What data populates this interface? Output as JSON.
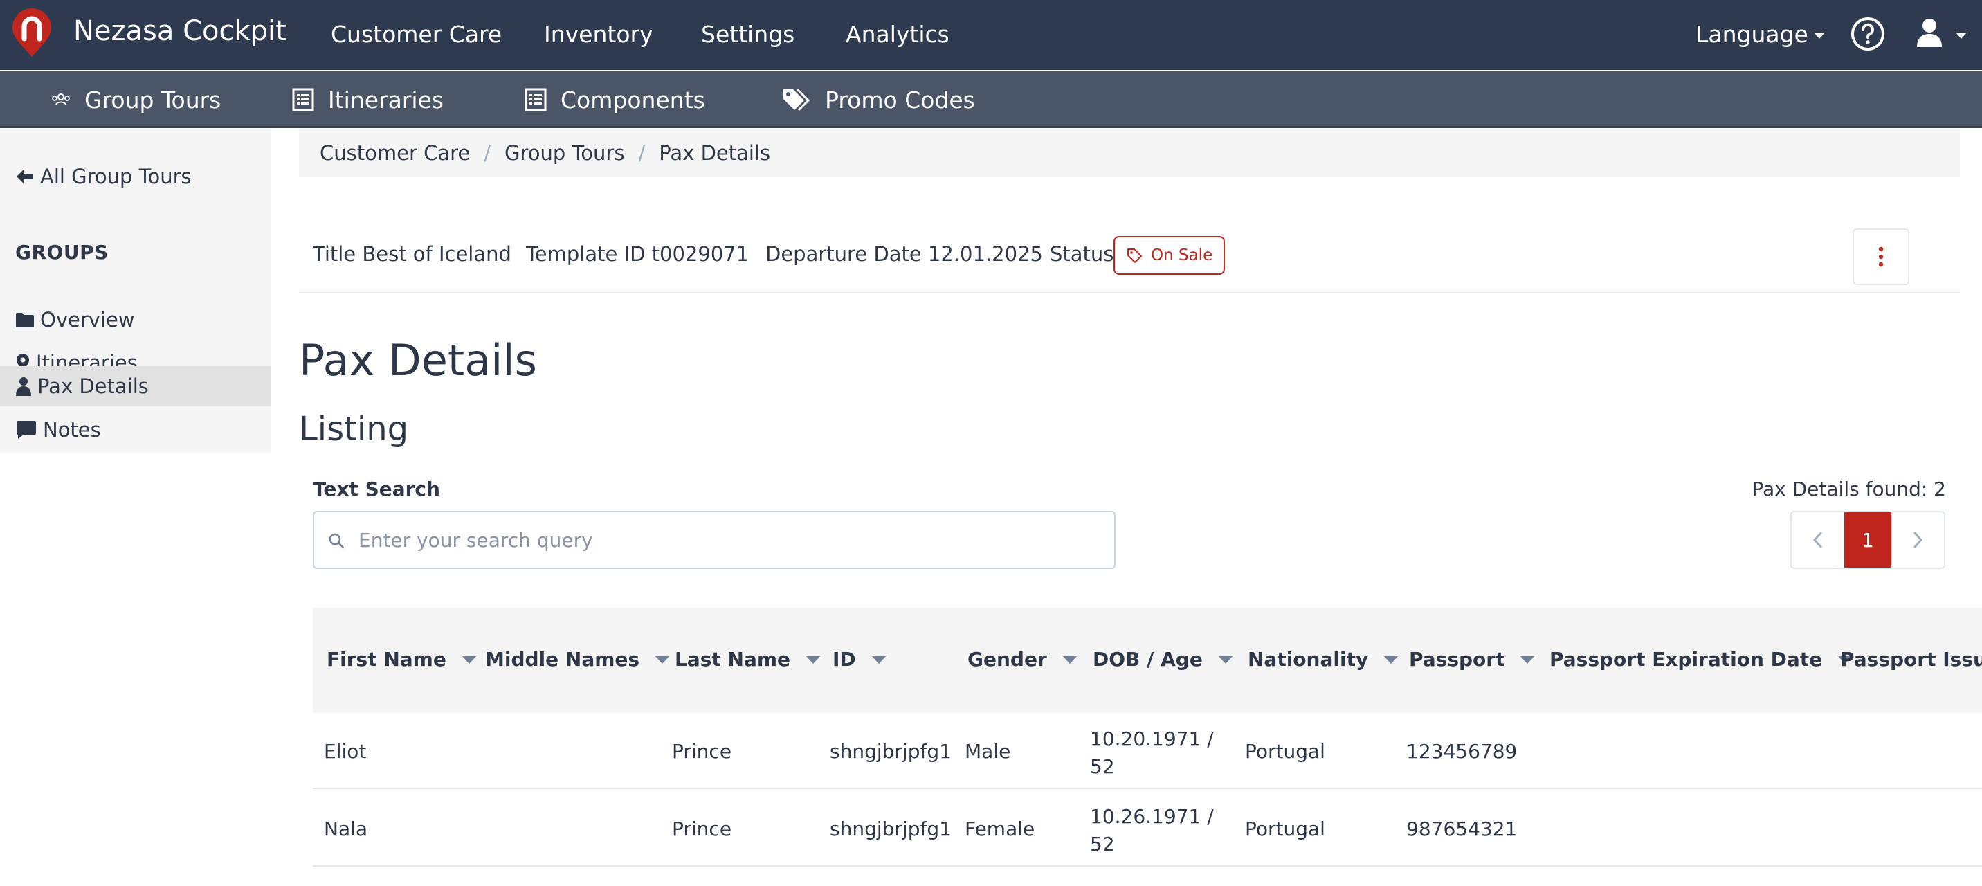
{
  "app": {
    "brand": "Nezasa Cockpit",
    "logo_color": "#c0261e",
    "accent": "#c0261e",
    "nav_bg": "#2e3a4f",
    "subnav_bg": "#4a5568"
  },
  "topnav": {
    "items": [
      {
        "label": "Customer Care"
      },
      {
        "label": "Inventory"
      },
      {
        "label": "Settings"
      },
      {
        "label": "Analytics"
      }
    ],
    "language_label": "Language",
    "help_icon": "question-circle-icon",
    "user_icon": "user-icon"
  },
  "subnav": {
    "items": [
      {
        "label": "Group Tours",
        "icon": "users-icon"
      },
      {
        "label": "Itineraries",
        "icon": "list-icon"
      },
      {
        "label": "Components",
        "icon": "list-icon"
      },
      {
        "label": "Promo Codes",
        "icon": "tags-icon"
      }
    ]
  },
  "sidebar": {
    "back_label": "All Group Tours",
    "heading": "GROUPS",
    "items": [
      {
        "label": "Overview",
        "icon": "folder-icon"
      },
      {
        "label": "Itineraries",
        "icon": "map-marker-icon"
      },
      {
        "label": "Pax Details",
        "icon": "user-icon",
        "active": true
      },
      {
        "label": "Notes",
        "icon": "comment-icon"
      }
    ]
  },
  "breadcrumb": [
    "Customer Care",
    "Group Tours",
    "Pax Details"
  ],
  "info": {
    "title": "Title Best of Iceland",
    "template_id": "Template ID t0029071",
    "departure": "Departure Date 12.01.2025",
    "status_label": "Status",
    "status_value": "On Sale"
  },
  "page": {
    "title": "Pax Details",
    "section": "Listing"
  },
  "search": {
    "label": "Text Search",
    "placeholder": "Enter your search query",
    "value": ""
  },
  "results": {
    "found_text": "Pax Details found: 2",
    "current_page": "1"
  },
  "table": {
    "columns": [
      "First Name",
      "Middle Names",
      "Last Name",
      "ID",
      "Gender",
      "DOB / Age",
      "Nationality",
      "Passport",
      "Passport Expiration Date",
      "Passport Issuing"
    ],
    "rows": [
      {
        "first": "Eliot",
        "middle": "",
        "last": "Prince",
        "id": "shngjbrjpfg1",
        "gender": "Male",
        "dob": "10.20.1971 /",
        "age": "52",
        "nationality": "Portugal",
        "passport": "123456789"
      },
      {
        "first": "Nala",
        "middle": "",
        "last": "Prince",
        "id": "shngjbrjpfg1",
        "gender": "Female",
        "dob": "10.26.1971 /",
        "age": "52",
        "nationality": "Portugal",
        "passport": "987654321"
      }
    ]
  }
}
